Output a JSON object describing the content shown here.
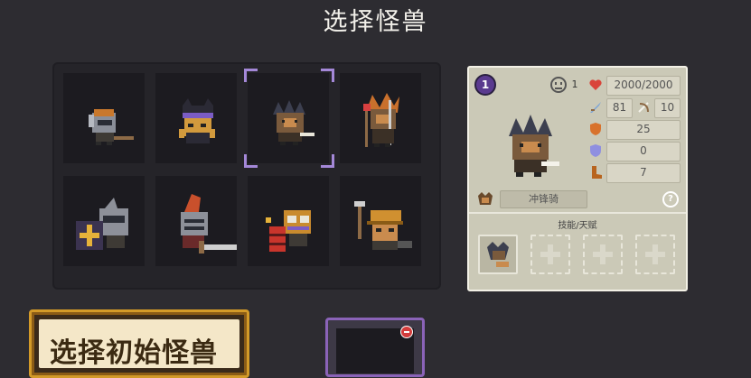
{
  "header": {
    "title": "选择怪兽"
  },
  "grid": {
    "monsters": [
      {
        "name": "monster-helmet-lizard",
        "selected": false
      },
      {
        "name": "monster-ninja-cat",
        "selected": false
      },
      {
        "name": "monster-spiked-boar",
        "selected": true
      },
      {
        "name": "monster-shaman-boar",
        "selected": false
      },
      {
        "name": "monster-shield-knight",
        "selected": false
      },
      {
        "name": "monster-plume-knight",
        "selected": false
      },
      {
        "name": "monster-dynamite-goblin",
        "selected": false
      },
      {
        "name": "monster-miner-goblin",
        "selected": false
      }
    ]
  },
  "info": {
    "level": "1",
    "mood_count": "1",
    "hp": "2000/2000",
    "attack": "81",
    "range": "10",
    "armor": "25",
    "magic_resist": "0",
    "speed": "7",
    "class_label": "冲锋骑",
    "help": "?",
    "skills_title": "技能/天赋",
    "colors": {
      "panel": "#cbc9b7",
      "accent": "#a488d8"
    }
  },
  "footer": {
    "start_label": "选择初始怪兽"
  }
}
